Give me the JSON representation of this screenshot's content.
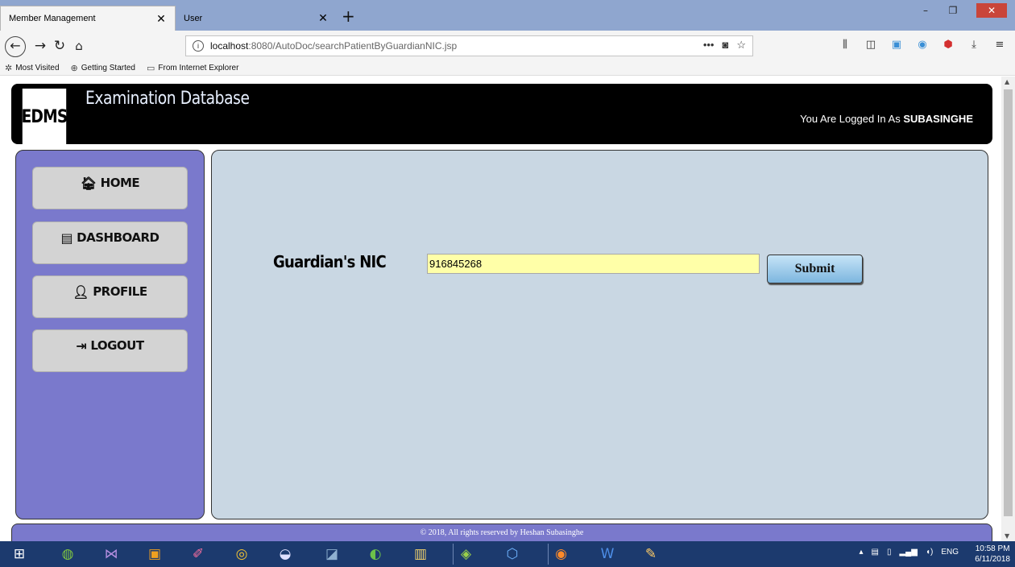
{
  "browser": {
    "tabs": [
      {
        "label": "Member Management"
      },
      {
        "label": "User"
      }
    ],
    "url_host": "localhost",
    "url_path": ":8080/AutoDoc/searchPatientByGuardianNIC.jsp",
    "bookmarks": [
      {
        "label": "Most Visited"
      },
      {
        "label": "Getting Started"
      },
      {
        "label": "From Internet Explorer"
      }
    ]
  },
  "header": {
    "logo": "EDMS",
    "title": "Examination Database",
    "logged_in_prefix": "You Are Logged In As ",
    "username": "SUBASINGHE"
  },
  "sidebar": {
    "items": [
      {
        "label": "HOME",
        "icon": "home-icon"
      },
      {
        "label": "DASHBOARD",
        "icon": "dashboard-icon"
      },
      {
        "label": "PROFILE",
        "icon": "user-icon"
      },
      {
        "label": "LOGOUT",
        "icon": "logout-icon"
      }
    ]
  },
  "form": {
    "label": "Guardian's NIC",
    "value": "916845268",
    "submit_label": "Submit"
  },
  "footer": {
    "text": "© 2018, All rights reserved by Heshan Subasinghe"
  },
  "taskbar": {
    "language": "ENG",
    "time": "10:58 PM",
    "date": "6/11/2018"
  },
  "colors": {
    "sidebar_bg": "#7a79cc",
    "main_bg": "#c9d7e3",
    "input_bg": "#ffffa8",
    "header_bg": "#000000"
  }
}
